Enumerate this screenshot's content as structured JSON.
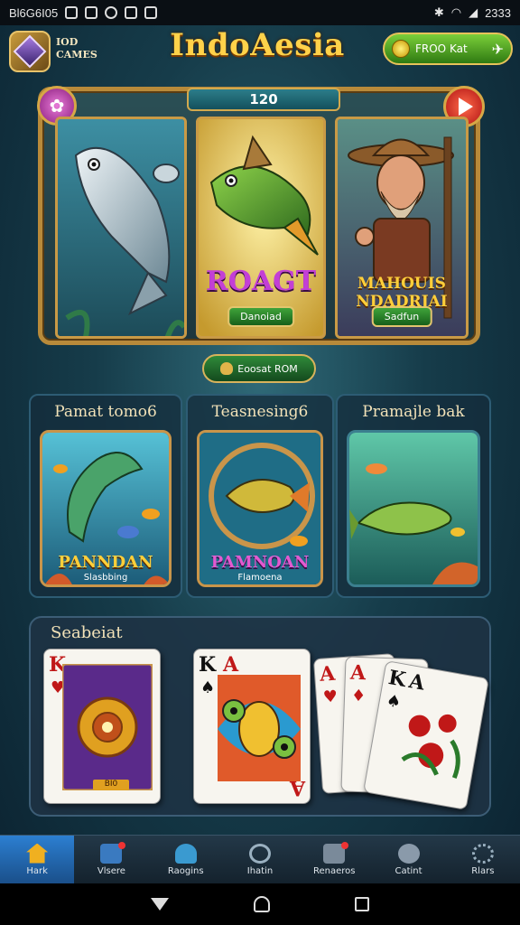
{
  "status_bar": {
    "left_text": "Bl6G6I05",
    "time": "2333"
  },
  "header": {
    "brand_line1": "IOD",
    "brand_line2": "CAMES",
    "title": "IndoAesia",
    "promo_label": "FROO Kat"
  },
  "carousel": {
    "counter": "120",
    "panels": [
      {
        "title": "",
        "button": ""
      },
      {
        "title": "ROAGT",
        "button": "Danoiad"
      },
      {
        "title_line1": "MAHOUIS",
        "title_line2": "NDADRJAI",
        "button": "Sadfun"
      }
    ]
  },
  "collect_button": "Eoosat ROM",
  "categories": [
    {
      "title": "Pamat tomo6",
      "label": "PANNDAN",
      "sub": "Slasbbing"
    },
    {
      "title": "Teasnesing6",
      "label": "PAMNOAN",
      "sub": "Flamoena"
    },
    {
      "title": "Pramajle bak",
      "label": "",
      "sub": ""
    }
  ],
  "cards_section": {
    "title": "Seabeiat",
    "card1_tag": "BI0",
    "cards": [
      "K",
      "A",
      "A",
      "A",
      "K",
      "A"
    ]
  },
  "tabs": [
    {
      "label": "Hark",
      "active": true
    },
    {
      "label": "Vlsere",
      "badge": true
    },
    {
      "label": "Raogins"
    },
    {
      "label": "Ihatin"
    },
    {
      "label": "Renaeros",
      "badge": true
    },
    {
      "label": "Catint"
    },
    {
      "label": "Rlars"
    }
  ],
  "colors": {
    "title_gold": "#ffd24a",
    "frame_gold": "#b88a3a",
    "tab_active": "#2c7fd1",
    "button_green": "#3fa33a"
  }
}
